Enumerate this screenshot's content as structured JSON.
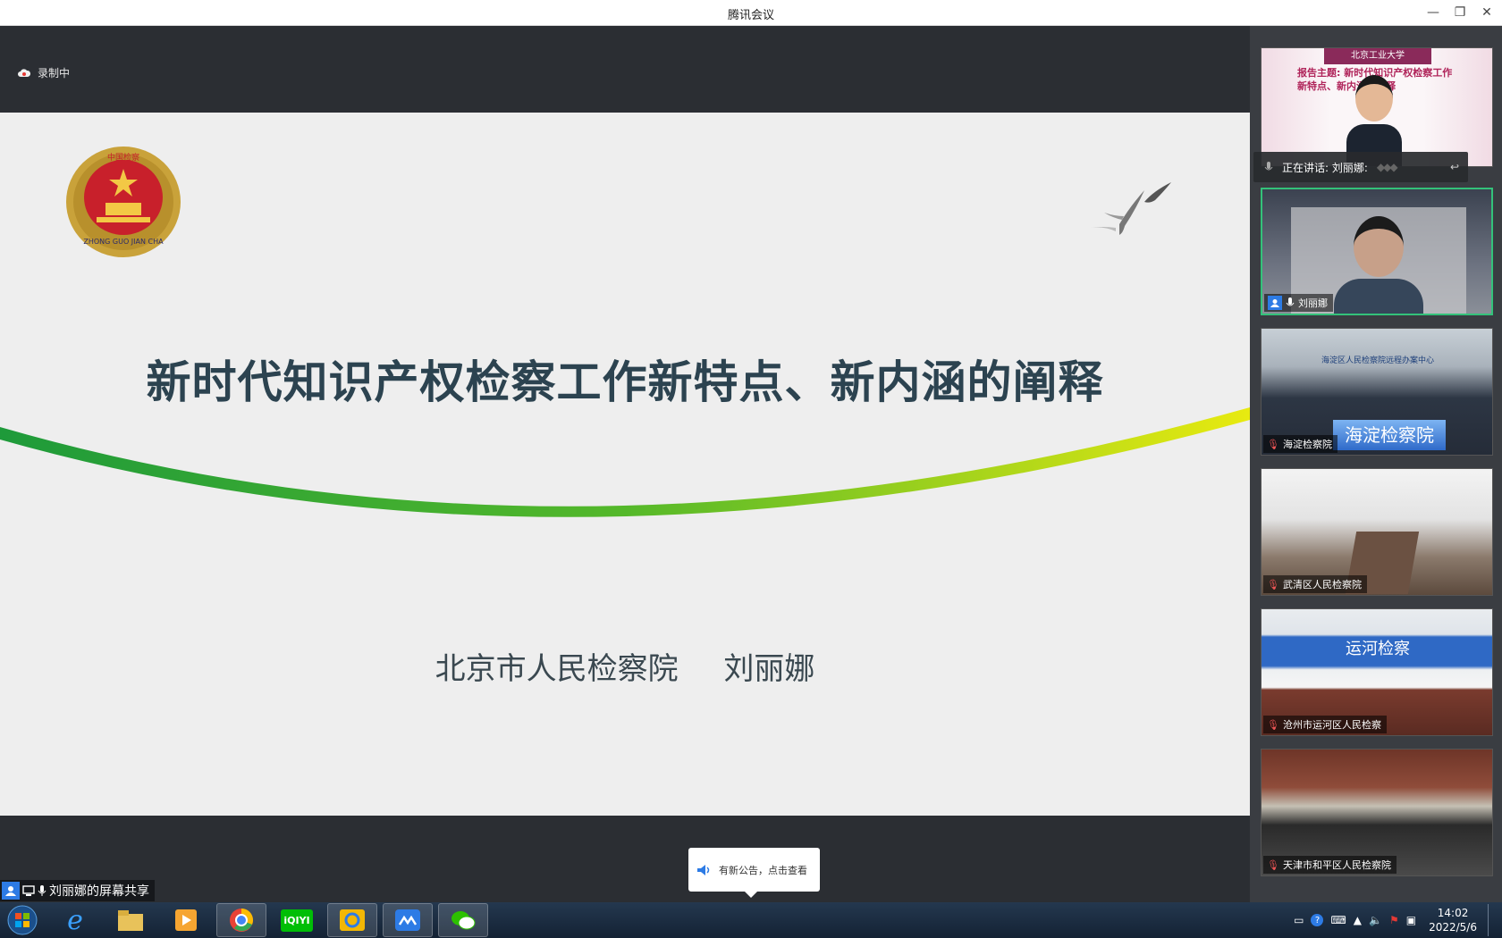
{
  "window": {
    "title": "腾讯会议",
    "controls": [
      "minimize-icon",
      "restore-icon",
      "close-icon"
    ]
  },
  "recording": {
    "label": "录制中",
    "icon": "cloud-record-icon"
  },
  "slide": {
    "title": "新时代知识产权检察工作新特点、新内涵的阐释",
    "org": "北京市人民检察院",
    "presenter": "刘丽娜",
    "emblem_text": "ZHONG GUO JIAN CHA",
    "emblem_top": "中国检察"
  },
  "notice": {
    "text": "有新公告，点击查看",
    "icon": "speaker-icon"
  },
  "share_label": {
    "text": "刘丽娜的屏幕共享"
  },
  "speaking": {
    "text": "正在讲话: 刘丽娜:"
  },
  "participants": [
    {
      "name": "",
      "label_top": "报告主题: 新时代知识产权检察工作新特点、新内涵的阐释",
      "uni": "北京工业大学"
    },
    {
      "name": "刘丽娜"
    },
    {
      "name": "海淀检察院",
      "banner": "海淀检察院",
      "wall": "海淀区人民检察院远程办案中心"
    },
    {
      "name": "武清区人民检察院"
    },
    {
      "name": "沧州市运河区人民检察",
      "wall": "运河检察"
    },
    {
      "name": "天津市和平区人民检察院"
    }
  ],
  "taskbar": {
    "apps": [
      "start-icon",
      "ie-icon",
      "explorer-icon",
      "media-player-icon",
      "browser-icon",
      "iqiyi-icon",
      "qq-browser-icon",
      "tencent-meeting-icon",
      "wechat-icon"
    ],
    "clock_time": "14:02",
    "clock_date": "2022/5/6",
    "iqiyi_label": "iQIYI"
  },
  "colors": {
    "accent": "#33c27a",
    "title_text": "#2c4350",
    "titlebar": "#ffffff"
  }
}
